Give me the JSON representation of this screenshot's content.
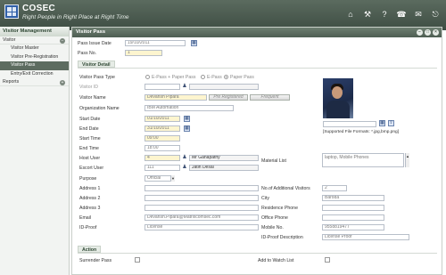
{
  "app": {
    "name": "COSEC",
    "tagline": "Right People in Right Place at Right Time"
  },
  "topbar_icons": [
    "home-icon",
    "tools-icon",
    "help-icon",
    "phone-icon",
    "message-icon",
    "logout-icon"
  ],
  "sidebar": {
    "header": "Visitor Management",
    "sections": [
      {
        "label": "Visitor",
        "items": [
          "Visitor Master",
          "Visitor Pre-Registration",
          "Visitor Pass",
          "Entry/Exit Correction"
        ]
      },
      {
        "label": "Reports"
      }
    ],
    "active_item": "Visitor Pass"
  },
  "main": {
    "title": "Visitor Pass",
    "pass_issue_date_label": "Pass Issue Date",
    "pass_issue_date": "19/10/2011",
    "pass_no_label": "Pass No.",
    "pass_no": "1",
    "visitor_detail_title": "Visitor Detail",
    "visitor_pass_type_label": "Visitor Pass Type",
    "pass_type_options": [
      "E-Pass + Paper Pass",
      "E-Pass",
      "Paper Pass"
    ],
    "pass_type_selected": "Paper Pass",
    "visitor_id_label": "Visitor ID",
    "visitor_name_label": "Visitor Name",
    "visitor_name": "Devansh Pipara",
    "pre_registered_btn": "Pre Registered",
    "frequent_btn": "Frequent",
    "organization_label": "Organization Name",
    "organization": "IBM Automation",
    "start_date_label": "Start Date",
    "start_date": "01/10/2011",
    "end_date_label": "End Date",
    "end_date": "31/10/2011",
    "start_time_label": "Start Time",
    "start_time": "09:00",
    "end_time_label": "End Time",
    "end_time": "18:00",
    "host_user_label": "Host User",
    "host_user_id": "4",
    "host_user_name": "Mr Ganapathy",
    "escort_user_label": "Escort User",
    "escort_user_id": "111",
    "escort_user_name": "Jatin Desai",
    "purpose_label": "Purpose",
    "purpose": "Official",
    "address1_label": "Address 1",
    "address2_label": "Address 2",
    "address3_label": "Address 3",
    "email_label": "Email",
    "email": "Devansh.Pipara@Matrixcomsec.com",
    "id_proof_label": "ID-Proof",
    "id_proof": "License",
    "material_list_label": "Material List",
    "material_list": "laptop, Mobile Phones",
    "additional_visitors_label": "No.of Additional Visitors",
    "additional_visitors": "2",
    "city_label": "City",
    "city": "Baroda",
    "residence_phone_label": "Residence Phone",
    "office_phone_label": "Office Phone",
    "mobile_label": "Mobile No.",
    "mobile": "9558819477",
    "id_proof_desc_label": "ID-Proof Description",
    "id_proof_desc": "License Proof",
    "supported_formats": "[Supported File Formats: *.jpg,bmp,png]",
    "action_title": "Action",
    "surrender_pass_label": "Surrender Pass",
    "add_watch_list_label": "Add to Watch List"
  }
}
